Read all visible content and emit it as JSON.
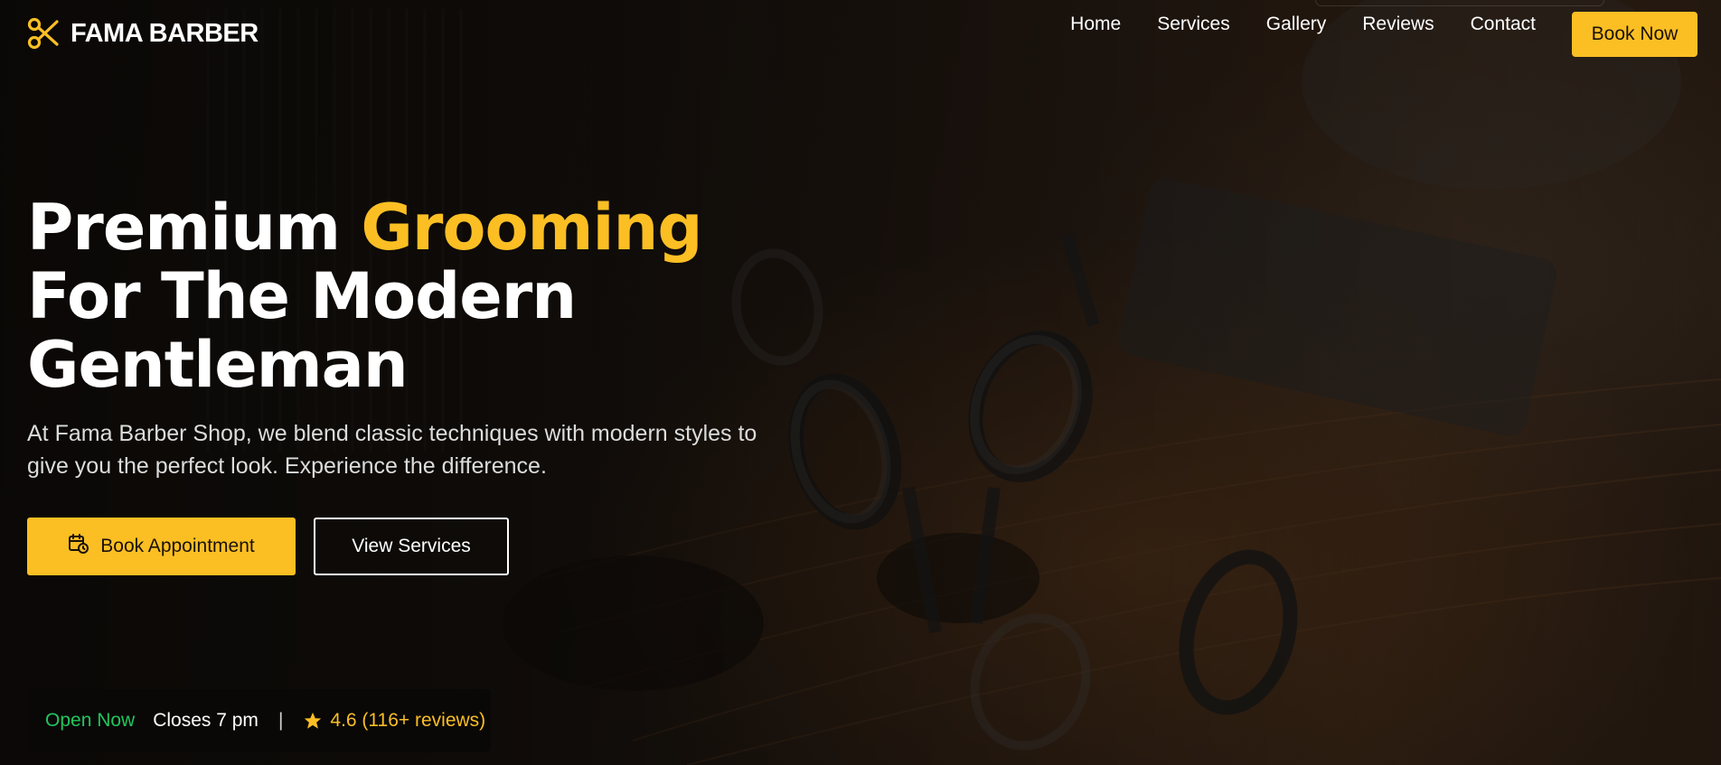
{
  "brand": {
    "name": "FAMA BARBER",
    "logo_icon": "scissors-icon"
  },
  "nav": {
    "items": [
      "Home",
      "Services",
      "Gallery",
      "Reviews",
      "Contact"
    ],
    "cta_label": "Book Now"
  },
  "hero": {
    "headline_part1": "Premium ",
    "headline_accent": "Grooming",
    "headline_line2": "For The Modern",
    "headline_line3": "Gentleman",
    "subtext": "At Fama Barber Shop, we blend classic techniques with modern styles to give you the perfect look. Experience the difference.",
    "primary_cta": {
      "label": "Book Appointment",
      "icon": "calendar-clock-icon"
    },
    "secondary_cta": {
      "label": "View Services"
    }
  },
  "status": {
    "open_label": "Open Now",
    "closes_label": "Closes 7 pm",
    "separator": "|",
    "rating_icon": "star-icon",
    "rating_text": "4.6 (116+ reviews)"
  },
  "colors": {
    "accent": "#fbbf24",
    "open_green": "#22c55e",
    "background": "#140f0b"
  }
}
